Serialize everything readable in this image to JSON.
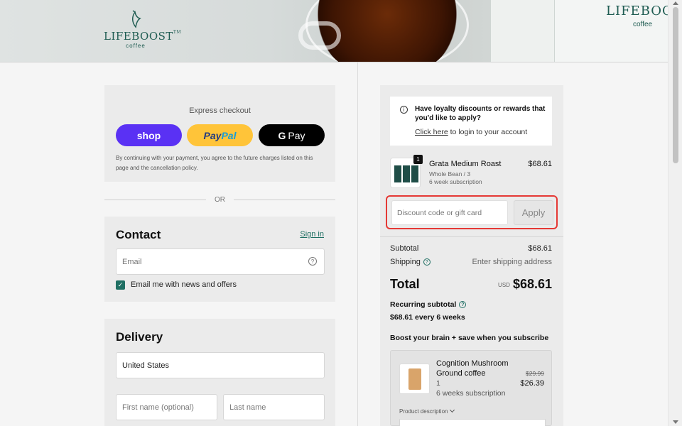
{
  "banner": {
    "brand": "LIFEBOOST",
    "tm": "TM",
    "sub": "coffee",
    "bag_brand": "LIFEBOOST",
    "bag_sub": "coffee"
  },
  "express": {
    "title": "Express checkout",
    "shop_label": "shop",
    "paypal_pay": "Pay",
    "paypal_pal": "Pal",
    "gpay_g": "G",
    "gpay_label": "Pay",
    "note": "By continuing with your payment, you agree to the future charges listed on this page and the cancellation policy."
  },
  "divider": {
    "or": "OR"
  },
  "contact": {
    "title": "Contact",
    "signin": "Sign in",
    "email_placeholder": "Email",
    "help": "?",
    "newsletter_label": "Email me with news and offers",
    "newsletter_checked": "✓"
  },
  "delivery": {
    "title": "Delivery",
    "country": "United States",
    "first_name_placeholder": "First name (optional)",
    "last_name_placeholder": "Last name"
  },
  "summary": {
    "loyalty": {
      "info": "i",
      "title": "Have loyalty discounts or rewards that you'd like to apply?",
      "link": "Click here",
      "link_suffix": " to login to your account"
    },
    "product": {
      "qty": "1",
      "name": "Grata Medium Roast",
      "variant": "Whole Bean / 3",
      "subscription": "6 week subscription",
      "price": "$68.61"
    },
    "discount": {
      "placeholder": "Discount code or gift card",
      "apply": "Apply"
    },
    "subtotal_label": "Subtotal",
    "subtotal_value": "$68.61",
    "shipping_label": "Shipping",
    "shipping_help": "?",
    "shipping_value": "Enter shipping address",
    "total_label": "Total",
    "total_currency": "USD",
    "total_value": "$68.61",
    "recurring_label": "Recurring subtotal",
    "recurring_help": "?",
    "recurring_value": "$68.61 every 6 weeks",
    "boost_title": "Boost your brain + save when you subscribe",
    "upsell": {
      "name": "Cognition Mushroom Ground coffee",
      "qty": "1",
      "subscription": "6 weeks subscription",
      "old_price": "$29.99",
      "new_price": "$26.39",
      "description_toggle": "Product description"
    }
  },
  "colors": {
    "accent": "#1f6f63",
    "shop": "#5a31f4",
    "paypal": "#ffc439",
    "highlight": "#e53935"
  }
}
